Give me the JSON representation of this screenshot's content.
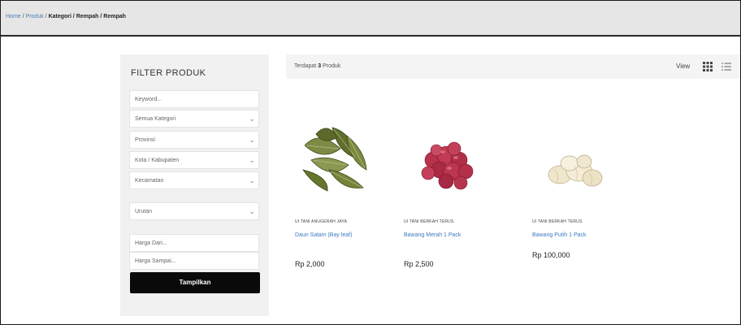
{
  "breadcrumb": [
    {
      "label": "Home",
      "type": "link"
    },
    {
      "label": "Produk",
      "type": "link"
    },
    {
      "label": "Kategori",
      "type": "current"
    },
    {
      "label": "Rempah",
      "type": "current"
    },
    {
      "label": "Rempah",
      "type": "current"
    }
  ],
  "sidebar": {
    "title": "FILTER PRODUK",
    "keyword_placeholder": "Keyword...",
    "selects": {
      "kategori": "Semua Kategori",
      "provinsi": "Provinsi",
      "kota": "Kota / Kabupaten",
      "kecamatan": "Kecamatan",
      "urutan": "Urutan"
    },
    "price_from_placeholder": "Harga Dari...",
    "price_to_placeholder": "Harga Sampai...",
    "submit_label": "Tampilkan"
  },
  "results": {
    "prefix": "Terdapat",
    "count": "3",
    "suffix": "Produk",
    "view_label": "View"
  },
  "products": [
    {
      "seller": "UI TANI ANUGERAH JAYA",
      "name": "Daun Salam (Bay leaf)",
      "price": "Rp 2,000",
      "image": "bay-leaves"
    },
    {
      "seller": "UI TANI BERKAH TERUS",
      "name": "Bawang Merah 1 Pack",
      "price": "Rp 2,500",
      "image": "shallots"
    },
    {
      "seller": "UI TANI BERKAH TERUS",
      "name": "Bawang Putih 1 Pack",
      "price": "Rp 100,000",
      "image": "garlic"
    }
  ],
  "icons": {
    "chevron": "chevron-down-icon",
    "grid": "grid-view-icon",
    "list": "list-view-icon"
  }
}
